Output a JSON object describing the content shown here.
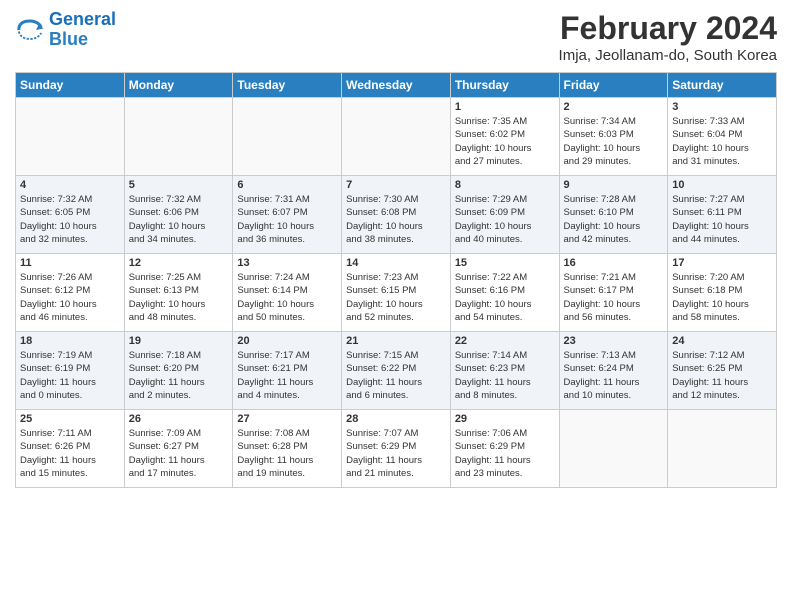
{
  "logo": {
    "line1": "General",
    "line2": "Blue"
  },
  "title": "February 2024",
  "subtitle": "Imja, Jeollanam-do, South Korea",
  "header": {
    "days": [
      "Sunday",
      "Monday",
      "Tuesday",
      "Wednesday",
      "Thursday",
      "Friday",
      "Saturday"
    ]
  },
  "weeks": [
    [
      {
        "day": "",
        "info": ""
      },
      {
        "day": "",
        "info": ""
      },
      {
        "day": "",
        "info": ""
      },
      {
        "day": "",
        "info": ""
      },
      {
        "day": "1",
        "info": "Sunrise: 7:35 AM\nSunset: 6:02 PM\nDaylight: 10 hours\nand 27 minutes."
      },
      {
        "day": "2",
        "info": "Sunrise: 7:34 AM\nSunset: 6:03 PM\nDaylight: 10 hours\nand 29 minutes."
      },
      {
        "day": "3",
        "info": "Sunrise: 7:33 AM\nSunset: 6:04 PM\nDaylight: 10 hours\nand 31 minutes."
      }
    ],
    [
      {
        "day": "4",
        "info": "Sunrise: 7:32 AM\nSunset: 6:05 PM\nDaylight: 10 hours\nand 32 minutes."
      },
      {
        "day": "5",
        "info": "Sunrise: 7:32 AM\nSunset: 6:06 PM\nDaylight: 10 hours\nand 34 minutes."
      },
      {
        "day": "6",
        "info": "Sunrise: 7:31 AM\nSunset: 6:07 PM\nDaylight: 10 hours\nand 36 minutes."
      },
      {
        "day": "7",
        "info": "Sunrise: 7:30 AM\nSunset: 6:08 PM\nDaylight: 10 hours\nand 38 minutes."
      },
      {
        "day": "8",
        "info": "Sunrise: 7:29 AM\nSunset: 6:09 PM\nDaylight: 10 hours\nand 40 minutes."
      },
      {
        "day": "9",
        "info": "Sunrise: 7:28 AM\nSunset: 6:10 PM\nDaylight: 10 hours\nand 42 minutes."
      },
      {
        "day": "10",
        "info": "Sunrise: 7:27 AM\nSunset: 6:11 PM\nDaylight: 10 hours\nand 44 minutes."
      }
    ],
    [
      {
        "day": "11",
        "info": "Sunrise: 7:26 AM\nSunset: 6:12 PM\nDaylight: 10 hours\nand 46 minutes."
      },
      {
        "day": "12",
        "info": "Sunrise: 7:25 AM\nSunset: 6:13 PM\nDaylight: 10 hours\nand 48 minutes."
      },
      {
        "day": "13",
        "info": "Sunrise: 7:24 AM\nSunset: 6:14 PM\nDaylight: 10 hours\nand 50 minutes."
      },
      {
        "day": "14",
        "info": "Sunrise: 7:23 AM\nSunset: 6:15 PM\nDaylight: 10 hours\nand 52 minutes."
      },
      {
        "day": "15",
        "info": "Sunrise: 7:22 AM\nSunset: 6:16 PM\nDaylight: 10 hours\nand 54 minutes."
      },
      {
        "day": "16",
        "info": "Sunrise: 7:21 AM\nSunset: 6:17 PM\nDaylight: 10 hours\nand 56 minutes."
      },
      {
        "day": "17",
        "info": "Sunrise: 7:20 AM\nSunset: 6:18 PM\nDaylight: 10 hours\nand 58 minutes."
      }
    ],
    [
      {
        "day": "18",
        "info": "Sunrise: 7:19 AM\nSunset: 6:19 PM\nDaylight: 11 hours\nand 0 minutes."
      },
      {
        "day": "19",
        "info": "Sunrise: 7:18 AM\nSunset: 6:20 PM\nDaylight: 11 hours\nand 2 minutes."
      },
      {
        "day": "20",
        "info": "Sunrise: 7:17 AM\nSunset: 6:21 PM\nDaylight: 11 hours\nand 4 minutes."
      },
      {
        "day": "21",
        "info": "Sunrise: 7:15 AM\nSunset: 6:22 PM\nDaylight: 11 hours\nand 6 minutes."
      },
      {
        "day": "22",
        "info": "Sunrise: 7:14 AM\nSunset: 6:23 PM\nDaylight: 11 hours\nand 8 minutes."
      },
      {
        "day": "23",
        "info": "Sunrise: 7:13 AM\nSunset: 6:24 PM\nDaylight: 11 hours\nand 10 minutes."
      },
      {
        "day": "24",
        "info": "Sunrise: 7:12 AM\nSunset: 6:25 PM\nDaylight: 11 hours\nand 12 minutes."
      }
    ],
    [
      {
        "day": "25",
        "info": "Sunrise: 7:11 AM\nSunset: 6:26 PM\nDaylight: 11 hours\nand 15 minutes."
      },
      {
        "day": "26",
        "info": "Sunrise: 7:09 AM\nSunset: 6:27 PM\nDaylight: 11 hours\nand 17 minutes."
      },
      {
        "day": "27",
        "info": "Sunrise: 7:08 AM\nSunset: 6:28 PM\nDaylight: 11 hours\nand 19 minutes."
      },
      {
        "day": "28",
        "info": "Sunrise: 7:07 AM\nSunset: 6:29 PM\nDaylight: 11 hours\nand 21 minutes."
      },
      {
        "day": "29",
        "info": "Sunrise: 7:06 AM\nSunset: 6:29 PM\nDaylight: 11 hours\nand 23 minutes."
      },
      {
        "day": "",
        "info": ""
      },
      {
        "day": "",
        "info": ""
      }
    ]
  ]
}
